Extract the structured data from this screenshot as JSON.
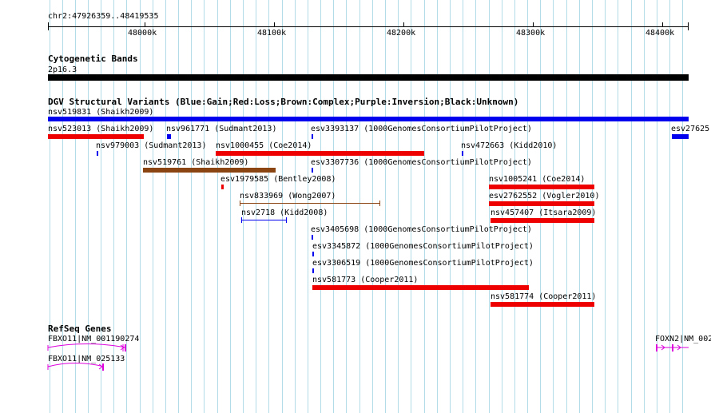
{
  "ruler": {
    "range_label": "chr2:47926359..48419535",
    "ticks": [
      {
        "label": "48000k",
        "kb": 48000
      },
      {
        "label": "48100k",
        "kb": 48100
      },
      {
        "label": "48200k",
        "kb": 48200
      },
      {
        "label": "48300k",
        "kb": 48300
      },
      {
        "label": "48400k",
        "kb": 48400
      }
    ]
  },
  "cyto": {
    "title": "Cytogenetic Bands",
    "band_label": "2p16.3"
  },
  "dgv": {
    "title": "DGV Structural Variants (Blue:Gain;Red:Loss;Brown:Complex;Purple:Inversion;Black:Unknown)",
    "colors": {
      "gain": "#0000ee",
      "loss": "#ee0000",
      "complex": "#8b4513",
      "unknown": "#000000"
    },
    "variants": [
      {
        "id": "nsv519831-variant",
        "label": "nsv519831 (Shaikh2009)",
        "type": "gain"
      },
      {
        "id": "nsv523013-variant",
        "label": "nsv523013 (Shaikh2009)",
        "type": "loss"
      },
      {
        "id": "nsv961771-variant",
        "label": "nsv961771 (Sudmant2013)",
        "type": "gain"
      },
      {
        "id": "esv3393137-variant",
        "label": "esv3393137 (1000GenomesConsortiumPilotProject)",
        "type": "gain"
      },
      {
        "id": "esv2762-variant",
        "label": "esv27625",
        "type": "gain"
      },
      {
        "id": "nsv979003-variant",
        "label": "nsv979003 (Sudmant2013)",
        "type": "gain"
      },
      {
        "id": "nsv1000455-variant",
        "label": "nsv1000455 (Coe2014)",
        "type": "loss"
      },
      {
        "id": "nsv472663-variant",
        "label": "nsv472663 (Kidd2010)",
        "type": "gain"
      },
      {
        "id": "nsv519761-variant",
        "label": "nsv519761 (Shaikh2009)",
        "type": "complex"
      },
      {
        "id": "esv3307736-variant",
        "label": "esv3307736 (1000GenomesConsortiumPilotProject)",
        "type": "gain"
      },
      {
        "id": "esv1979585-variant",
        "label": "esv1979585 (Bentley2008)",
        "type": "loss"
      },
      {
        "id": "nsv1005241-variant",
        "label": "nsv1005241 (Coe2014)",
        "type": "loss"
      },
      {
        "id": "nsv833969-variant",
        "label": "nsv833969 (Wong2007)",
        "type": "complex"
      },
      {
        "id": "esv2762552-variant",
        "label": "esv2762552 (Vogler2010)",
        "type": "loss"
      },
      {
        "id": "nsv2718-variant",
        "label": "nsv2718 (Kidd2008)",
        "type": "gain"
      },
      {
        "id": "nsv457407-variant",
        "label": "nsv457407 (Itsara2009)",
        "type": "loss"
      },
      {
        "id": "esv3405698-variant",
        "label": "esv3405698 (1000GenomesConsortiumPilotProject)",
        "type": "gain"
      },
      {
        "id": "esv3345872-variant",
        "label": "esv3345872 (1000GenomesConsortiumPilotProject)",
        "type": "gain"
      },
      {
        "id": "esv3306519-variant",
        "label": "esv3306519 (1000GenomesConsortiumPilotProject)",
        "type": "gain"
      },
      {
        "id": "nsv581773-variant",
        "label": "nsv581773 (Cooper2011)",
        "type": "loss"
      },
      {
        "id": "nsv581774-variant",
        "label": "nsv581774 (Cooper2011)",
        "type": "loss"
      }
    ]
  },
  "refseq": {
    "title": "RefSeq Genes",
    "gene_color": "#dd00dd",
    "genes": [
      {
        "id": "fbxo11-nm001190274",
        "label": "FBXO11|NM_001190274"
      },
      {
        "id": "fbxo11-nm025133",
        "label": "FBXO11|NM_025133"
      },
      {
        "id": "foxn2-gene",
        "label": "FOXN2|NM_002"
      }
    ]
  }
}
